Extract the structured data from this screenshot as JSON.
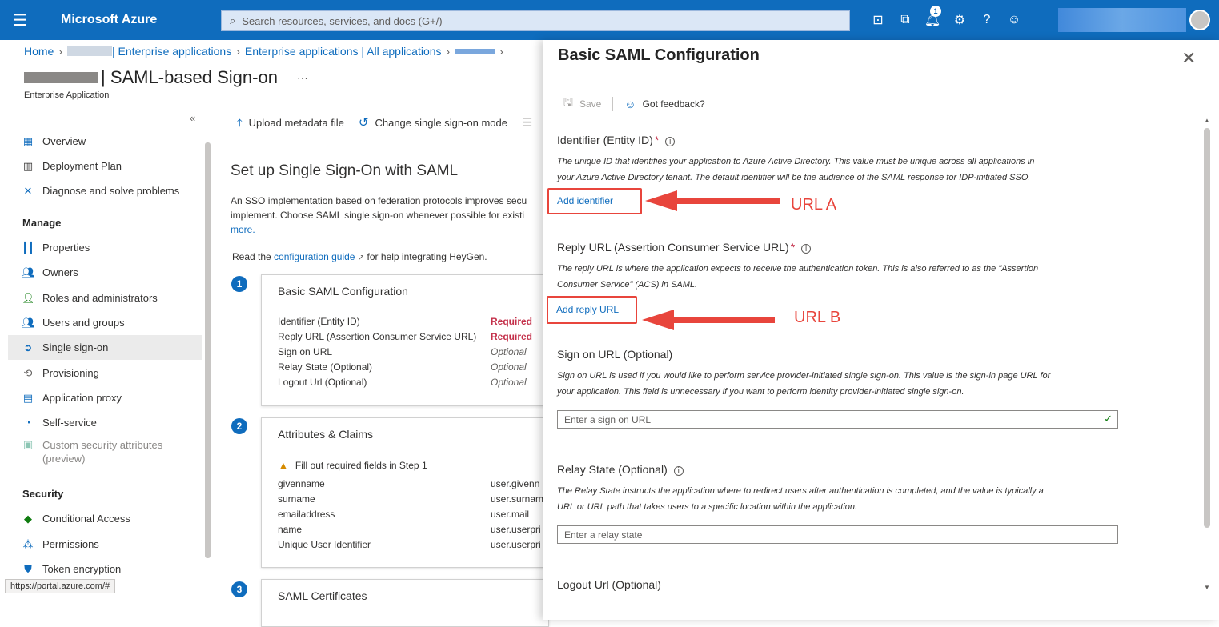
{
  "topbar": {
    "brand": "Microsoft Azure",
    "search_placeholder": "Search resources, services, and docs (G+/)",
    "notification_count": "1",
    "icons": [
      "cloud-shell-icon",
      "directory-filter-icon",
      "notification-bell-icon",
      "settings-gear-icon",
      "help-icon",
      "feedback-icon"
    ]
  },
  "breadcrumb": {
    "home": "Home",
    "item1": "| Enterprise applications",
    "item2": "Enterprise applications | All applications"
  },
  "page": {
    "title": "| SAML-based Sign-on",
    "more": "···",
    "subtitle": "Enterprise Application"
  },
  "nav": {
    "items": [
      {
        "label": "Overview",
        "icon": "grid-icon",
        "color": "#0f6cbd"
      },
      {
        "label": "Deployment Plan",
        "icon": "book-icon",
        "color": "#323130"
      },
      {
        "label": "Diagnose and solve problems",
        "icon": "wrench-icon",
        "color": "#0f6cbd"
      }
    ],
    "manage_header": "Manage",
    "manage": [
      {
        "label": "Properties",
        "icon": "properties-icon"
      },
      {
        "label": "Owners",
        "icon": "owners-icon"
      },
      {
        "label": "Roles and administrators",
        "icon": "roles-icon"
      },
      {
        "label": "Users and groups",
        "icon": "users-icon"
      },
      {
        "label": "Single sign-on",
        "icon": "sso-icon"
      },
      {
        "label": "Provisioning",
        "icon": "provisioning-icon"
      },
      {
        "label": "Application proxy",
        "icon": "app-proxy-icon"
      },
      {
        "label": "Self-service",
        "icon": "self-service-icon"
      },
      {
        "label": "Custom security attributes",
        "sub": "(preview)",
        "icon": "custom-attributes-icon"
      }
    ],
    "security_header": "Security",
    "security": [
      {
        "label": "Conditional Access",
        "icon": "conditional-access-icon"
      },
      {
        "label": "Permissions",
        "icon": "permissions-icon"
      },
      {
        "label": "Token encryption",
        "icon": "shield-icon"
      }
    ],
    "status_url": "https://portal.azure.com/#"
  },
  "main": {
    "toolbar": {
      "upload": "Upload metadata file",
      "change": "Change single sign-on mode"
    },
    "setup_title": "Set up Single Sign-On with SAML",
    "setup_desc_1": "An SSO implementation based on federation protocols improves secu",
    "setup_desc_2": "implement. Choose SAML single sign-on whenever possible for existi",
    "learn_more": "more.",
    "read_prefix": "Read the ",
    "read_link": "configuration guide",
    "read_suffix": " for help integrating HeyGen.",
    "step1": {
      "num": "1",
      "title": "Basic SAML Configuration",
      "rows": [
        {
          "label": "Identifier (Entity ID)",
          "value": "Required",
          "kind": "req"
        },
        {
          "label": "Reply URL (Assertion Consumer Service URL)",
          "value": "Required",
          "kind": "req"
        },
        {
          "label": "Sign on URL",
          "value": "Optional",
          "kind": "opt"
        },
        {
          "label": "Relay State (Optional)",
          "value": "Optional",
          "kind": "opt"
        },
        {
          "label": "Logout Url (Optional)",
          "value": "Optional",
          "kind": "opt"
        }
      ]
    },
    "step2": {
      "num": "2",
      "title": "Attributes & Claims",
      "warning": "Fill out required fields in Step 1",
      "rows": [
        {
          "label": "givenname",
          "value": "user.givenn"
        },
        {
          "label": "surname",
          "value": "user.surnam"
        },
        {
          "label": "emailaddress",
          "value": "user.mail"
        },
        {
          "label": "name",
          "value": "user.userpri"
        },
        {
          "label": "Unique User Identifier",
          "value": "user.userpri"
        }
      ]
    },
    "step3": {
      "num": "3",
      "title": "SAML Certificates"
    }
  },
  "panel": {
    "title": "Basic SAML Configuration",
    "save": "Save",
    "feedback": "Got feedback?",
    "identifier": {
      "title": "Identifier (Entity ID)",
      "star": "*",
      "desc1": "The unique ID that identifies your application to Azure Active Directory. This value must be unique across all applications in",
      "desc2": "your Azure Active Directory tenant. The default identifier will be the audience of the SAML response for IDP-initiated SSO.",
      "link": "Add identifier"
    },
    "reply": {
      "title": "Reply URL (Assertion Consumer Service URL)",
      "star": "*",
      "desc1": "The reply URL is where the application expects to receive the authentication token. This is also referred to as the \"Assertion",
      "desc2": "Consumer Service\" (ACS) in SAML.",
      "link": "Add reply URL"
    },
    "signon": {
      "title": "Sign on URL (Optional)",
      "desc1": "Sign on URL is used if you would like to perform service provider-initiated single sign-on. This value is the sign-in page URL for",
      "desc2": "your application. This field is unnecessary if you want to perform identity provider-initiated single sign-on.",
      "placeholder": "Enter a sign on URL"
    },
    "relay": {
      "title": "Relay State (Optional)",
      "desc1": "The Relay State instructs the application where to redirect users after authentication is completed, and the value is typically a",
      "desc2": "URL or URL path that takes users to a specific location within the application.",
      "placeholder": "Enter a relay state"
    },
    "logout": {
      "title": "Logout Url (Optional)"
    }
  },
  "annotations": {
    "a": "URL A",
    "b": "URL B",
    "color": "#e8453c"
  }
}
